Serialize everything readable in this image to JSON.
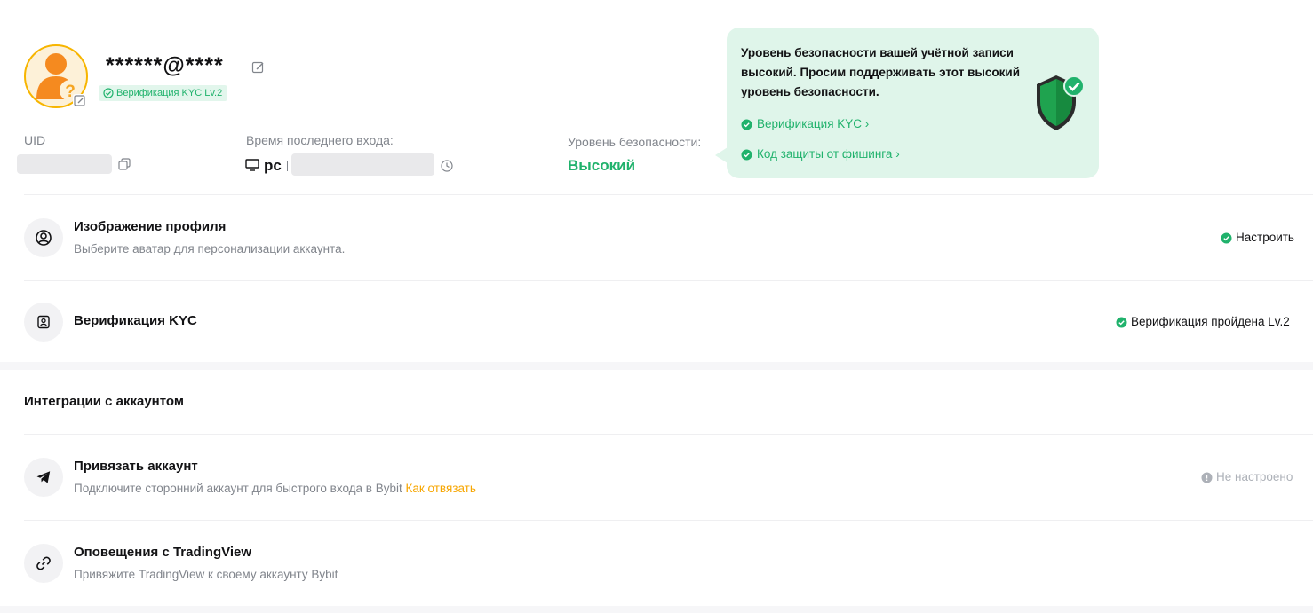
{
  "colors": {
    "accent_green": "#20b26c",
    "link_orange": "#f7a600",
    "tip_bg": "#dff5ea"
  },
  "profile": {
    "email": "******@****",
    "kyc_badge": "Верификация KYC Lv.2"
  },
  "info": {
    "uid_label": "UID",
    "last_login_label": "Время последнего входа:",
    "device": "pc",
    "security_label": "Уровень безопасности:",
    "security_value": "Высокий"
  },
  "security_tip": {
    "text": "Уровень безопасности вашей учётной записи высокий. Просим поддерживать этот высокий уровень безопасности.",
    "link_kyc": "Верификация KYC ›",
    "link_phishing": "Код защиты от фишинга ›"
  },
  "rows": {
    "avatar": {
      "title": "Изображение профиля",
      "subtitle": "Выберите аватар для персонализации аккаунта.",
      "status": "Настроить"
    },
    "kyc": {
      "title": "Верификация KYC",
      "status": "Верификация пройдена Lv.2"
    }
  },
  "integrations": {
    "section_title": "Интеграции с аккаунтом",
    "link_account": {
      "title": "Привязать аккаунт",
      "subtitle": "Подключите сторонний аккаунт для быстрого входа в Bybit",
      "link": "Как отвязать",
      "status": "Не настроено"
    },
    "tradingview": {
      "title": "Оповещения с TradingView",
      "subtitle": "Привяжите TradingView к своему аккаунту Bybit"
    }
  },
  "icons": [
    "user-avatar-icon",
    "edit-icon",
    "check-circle-icon",
    "copy-icon",
    "monitor-icon",
    "clock-icon",
    "shield-check-icon",
    "user-circle-icon",
    "id-card-icon",
    "telegram-icon",
    "link-icon",
    "info-circle-icon"
  ]
}
